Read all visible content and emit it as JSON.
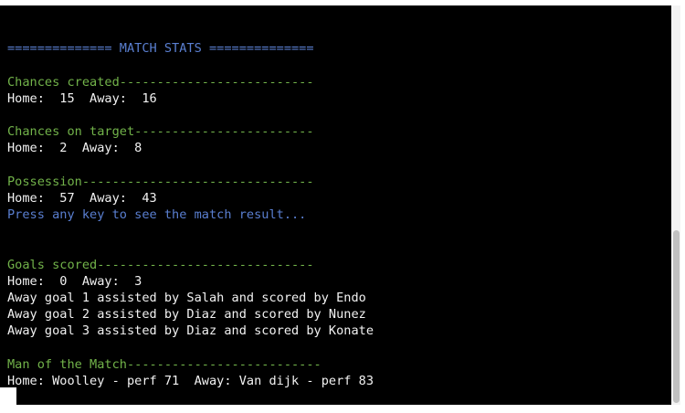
{
  "terminal": {
    "colors": {
      "background": "#000000",
      "blue": "#5a7fd1",
      "green": "#72b34a",
      "white": "#f2f2f2"
    },
    "lines": [
      {
        "text": "",
        "color": "white"
      },
      {
        "text": "============== MATCH STATS ==============",
        "color": "blue"
      },
      {
        "text": "",
        "color": "white"
      },
      {
        "text": "Chances created--------------------------",
        "color": "green"
      },
      {
        "text": "Home:  15  Away:  16",
        "color": "white"
      },
      {
        "text": "",
        "color": "white"
      },
      {
        "text": "Chances on target------------------------",
        "color": "green"
      },
      {
        "text": "Home:  2  Away:  8",
        "color": "white"
      },
      {
        "text": "",
        "color": "white"
      },
      {
        "text": "Possession-------------------------------",
        "color": "green"
      },
      {
        "text": "Home:  57  Away:  43",
        "color": "white"
      },
      {
        "text": "Press any key to see the match result...",
        "color": "blue"
      },
      {
        "text": "",
        "color": "white"
      },
      {
        "text": "",
        "color": "white"
      },
      {
        "text": "Goals scored-----------------------------",
        "color": "green"
      },
      {
        "text": "Home:  0  Away:  3",
        "color": "white"
      },
      {
        "text": "Away goal 1 assisted by Salah and scored by Endo",
        "color": "white"
      },
      {
        "text": "Away goal 2 assisted by Diaz and scored by Nunez",
        "color": "white"
      },
      {
        "text": "Away goal 3 assisted by Diaz and scored by Konate",
        "color": "white"
      },
      {
        "text": "",
        "color": "white"
      },
      {
        "text": "Man of the Match--------------------------",
        "color": "green"
      },
      {
        "text": "Home: Woolley - perf 71  Away: Van dijk - perf 83",
        "color": "white"
      }
    ]
  }
}
